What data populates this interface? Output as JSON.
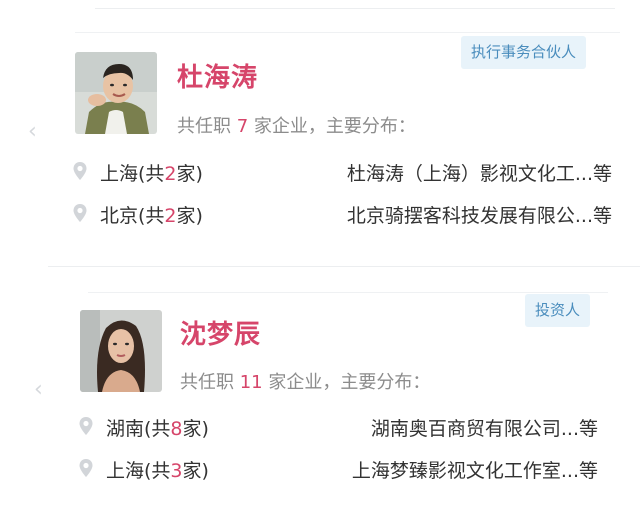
{
  "cards": [
    {
      "name": "杜海涛",
      "role": "执行事务合伙人",
      "summary": {
        "prefix": "共任职",
        "count": "7",
        "suffix": "家企业，主要分布："
      },
      "locations": [
        {
          "city_prefix": "上海(共",
          "num": "2",
          "city_suffix": "家)",
          "company": "杜海涛（上海）影视文化工...等"
        },
        {
          "city_prefix": "北京(共",
          "num": "2",
          "city_suffix": "家)",
          "company": "北京骑摆客科技发展有限公...等"
        }
      ]
    },
    {
      "name": "沈梦辰",
      "role": "投资人",
      "summary": {
        "prefix": "共任职",
        "count": "11",
        "suffix": "家企业，主要分布："
      },
      "locations": [
        {
          "city_prefix": "湖南(共",
          "num": "8",
          "city_suffix": "家)",
          "company": "湖南奥百商贸有限公司...等"
        },
        {
          "city_prefix": "上海(共",
          "num": "3",
          "city_suffix": "家)",
          "company": "上海梦臻影视文化工作室...等"
        }
      ]
    }
  ],
  "icons": {
    "nav": "chevron-left-icon",
    "location": "map-pin-icon"
  },
  "colors": {
    "name": "#d6456a",
    "badge_bg": "#e8f3fa",
    "badge_text": "#4a8dbd",
    "muted": "#8c8c8c",
    "body": "#333333"
  }
}
